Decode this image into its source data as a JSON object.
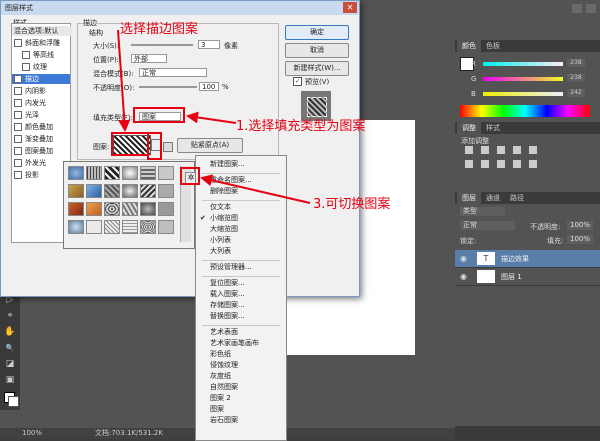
{
  "ps": {
    "tools": [
      "▷",
      "⌖",
      "✋",
      "🔍",
      "◪",
      "▣"
    ],
    "status_zoom": "100%",
    "status_doc": "文档:703.1K/531.2K",
    "color_tabs": [
      "颜色",
      "色板"
    ],
    "color_sliders": [
      {
        "label": "R",
        "value": "238"
      },
      {
        "label": "G",
        "value": "238"
      },
      {
        "label": "B",
        "value": "242"
      }
    ],
    "adjust_tabs": [
      "调整",
      "样式"
    ],
    "adjust_title": "添加调整",
    "layers_tabs": [
      "图层",
      "通道",
      "路径"
    ],
    "layer_filter": "类型",
    "blend_mode": "正常",
    "opacity_label": "不透明度:",
    "opacity_value": "100%",
    "lock_label": "锁定:",
    "fill_label": "填充:",
    "fill_value": "100%",
    "layers": [
      {
        "name": "描边效果",
        "thumb": "T"
      },
      {
        "name": "图层 1",
        "thumb": ""
      }
    ]
  },
  "dialog": {
    "title": "图层样式",
    "styles_header": "样式",
    "styles": [
      {
        "label": "混合选项:默认",
        "checkbox": false,
        "selected": false
      },
      {
        "label": "斜面和浮雕",
        "checkbox": true,
        "selected": false
      },
      {
        "label": "等高线",
        "checkbox": true,
        "selected": false
      },
      {
        "label": "纹理",
        "checkbox": true,
        "selected": false
      },
      {
        "label": "描边",
        "checkbox": true,
        "selected": true
      },
      {
        "label": "内阴影",
        "checkbox": true,
        "selected": false
      },
      {
        "label": "内发光",
        "checkbox": true,
        "selected": false
      },
      {
        "label": "光泽",
        "checkbox": true,
        "selected": false
      },
      {
        "label": "颜色叠加",
        "checkbox": true,
        "selected": false
      },
      {
        "label": "渐变叠加",
        "checkbox": true,
        "selected": false
      },
      {
        "label": "图案叠加",
        "checkbox": true,
        "selected": false
      },
      {
        "label": "外发光",
        "checkbox": true,
        "selected": false
      },
      {
        "label": "投影",
        "checkbox": true,
        "selected": false
      }
    ],
    "stroke_group": "描边",
    "structure_group": "结构",
    "size_label": "大小(S):",
    "size_value": "3",
    "size_unit": "像素",
    "position_label": "位置(P):",
    "position_value": "外部",
    "blend_label": "混合模式(B):",
    "blend_value": "正常",
    "opacity_label": "不透明度(O):",
    "opacity_value": "100",
    "opacity_unit": "%",
    "fill_type_label": "填充类型(F):",
    "fill_type_value": "图案",
    "pattern_label": "图案:",
    "snap_button": "贴紧原点(A)",
    "ok_button": "确定",
    "cancel_button": "取消",
    "new_style_button": "新建样式(W)...",
    "preview_label": "预览(V)"
  },
  "pattern_menu": {
    "items": [
      "新建图案...",
      "---",
      "重命名图案...",
      "删除图案",
      "---",
      "仅文本",
      "小缩览图",
      "大缩览图",
      "小列表",
      "大列表",
      "---",
      "预设管理器...",
      "---",
      "复位图案...",
      "载入图案...",
      "存储图案...",
      "替换图案...",
      "---",
      "艺术表面",
      "艺术家画笔画布",
      "彩色纸",
      "侵蚀纹理",
      "灰度纸",
      "自然图案",
      "图案 2",
      "图案",
      "岩石图案"
    ],
    "checked": "小缩览图"
  },
  "annotations": {
    "a1": "选择描边图案",
    "a2": "1.选择填充类型为图案",
    "a3": "3.可切换图案"
  },
  "colors": {
    "annotation_red": "#e60012",
    "selection_blue": "#3d7ad6"
  }
}
